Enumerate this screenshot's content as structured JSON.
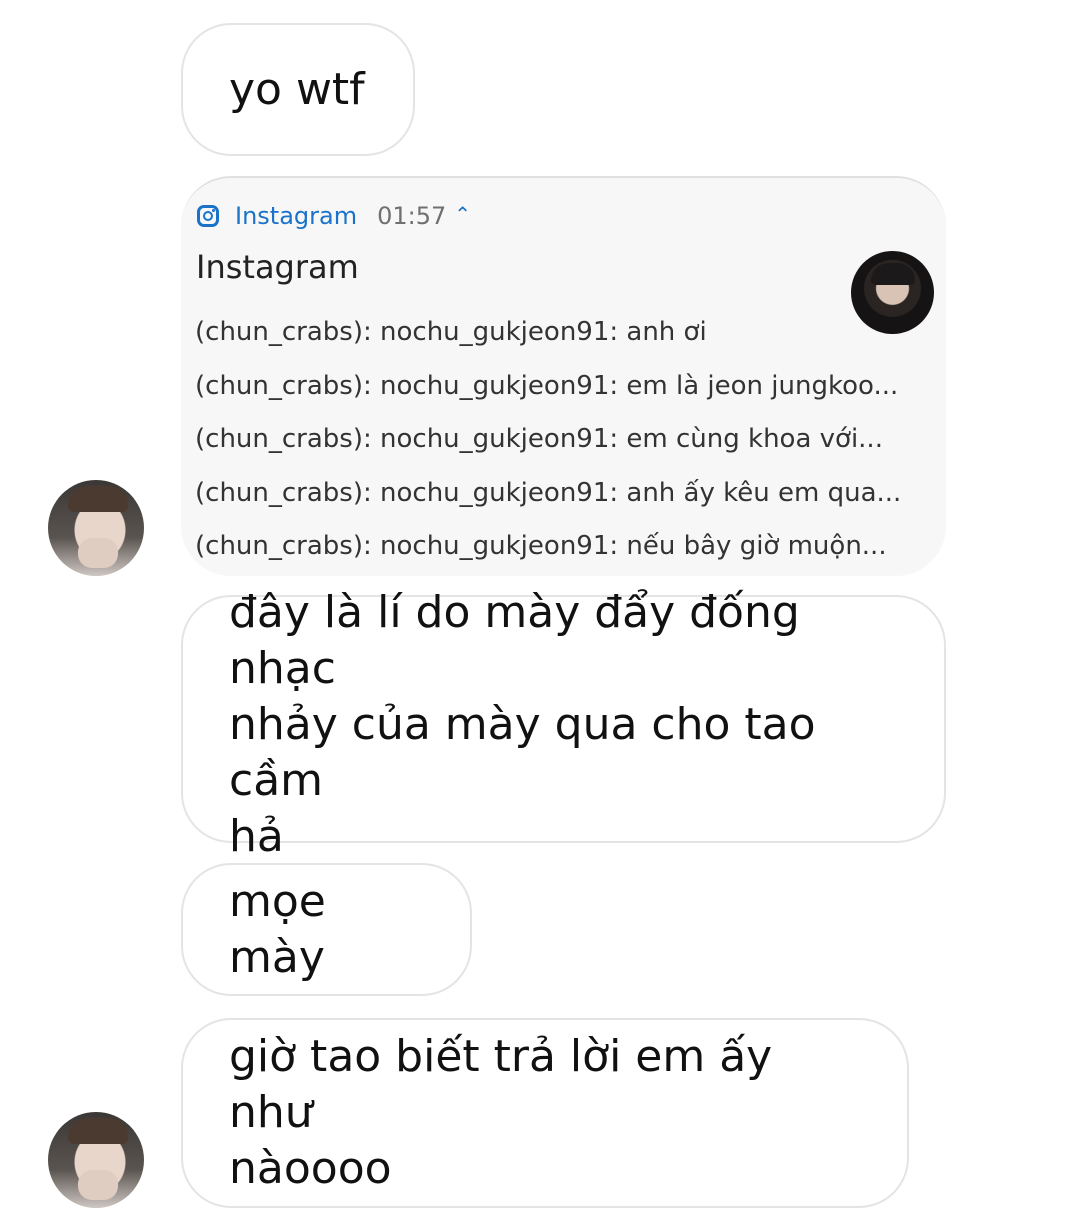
{
  "messages": [
    {
      "text": "yo wtf"
    },
    {
      "text": "đây là lí do mày đẩy đống nhạc\nnhảy của mày qua cho tao cầm\nhả"
    },
    {
      "text": "mọe mày"
    },
    {
      "text": "giờ tao biết trả lời em ấy như\nnàoooo"
    }
  ],
  "notification": {
    "app": "Instagram",
    "time": "01:57",
    "title": "Instagram",
    "lines": [
      "(chun_crabs): nochu_gukjeon91: anh ơi",
      "(chun_crabs): nochu_gukjeon91: em là jeon jungkoo...",
      "(chun_crabs): nochu_gukjeon91: em cùng khoa với...",
      "(chun_crabs): nochu_gukjeon91: anh ấy kêu em qua...",
      "(chun_crabs): nochu_gukjeon91: nếu bây giờ muộn..."
    ],
    "accent_color": "#1a73c9",
    "icons": [
      "instagram-icon",
      "chevron-up-icon"
    ]
  }
}
